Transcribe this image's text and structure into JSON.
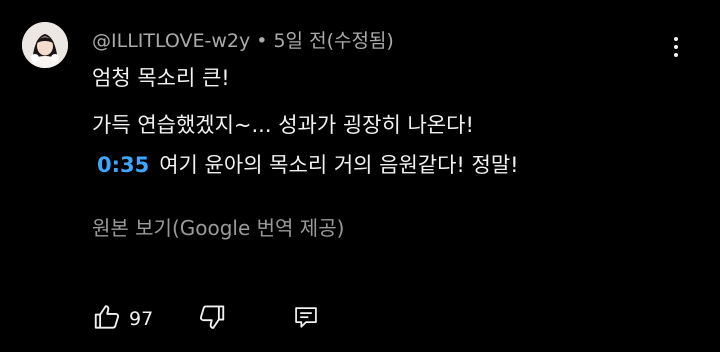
{
  "comment": {
    "author": "@ILLITLOVE-w2y",
    "separator": "•",
    "time_ago": "5일 전",
    "edited": "(수정됨)",
    "lines": [
      "엄청 목소리 큰!",
      "가득 연습했겠지~... 성과가 굉장히 나온다!"
    ],
    "timestamp_link": "0:35",
    "timestamp_text": "여기 윤아의 목소리 거의 음원같다! 정말!",
    "translate_link": "원본 보기(Google 번역 제공)",
    "like_count": "97"
  },
  "icons": {
    "avatar": "avatar-icon",
    "more": "more-vertical-icon",
    "like": "thumbs-up-icon",
    "dislike": "thumbs-down-icon",
    "reply": "reply-comment-icon"
  },
  "colors": {
    "background": "#000000",
    "text": "#f1f1f1",
    "secondary_text": "#aaaaaa",
    "timestamp_link": "#3ea6ff"
  }
}
